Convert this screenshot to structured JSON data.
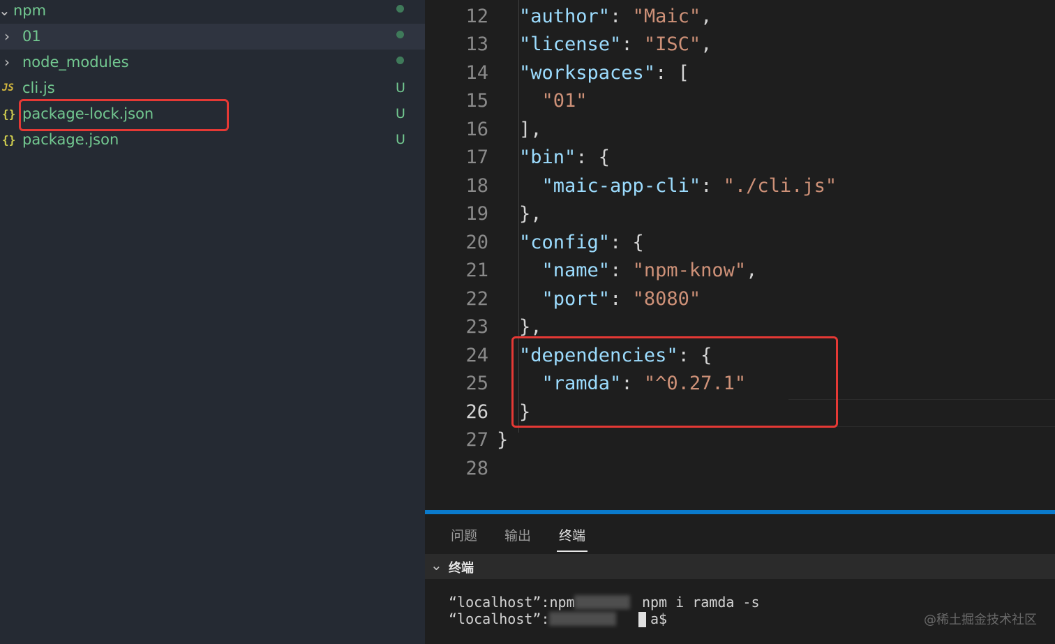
{
  "explorer": {
    "root_label": "npm",
    "items": [
      {
        "label": "01",
        "status": "dot"
      },
      {
        "label": "node_modules",
        "status": "dot"
      },
      {
        "label": "cli.js",
        "icon": "JS",
        "status": "U"
      },
      {
        "label": "package-lock.json",
        "icon": "{}",
        "status": "U"
      },
      {
        "label": "package.json",
        "icon": "{}",
        "status": "U"
      }
    ]
  },
  "editor": {
    "line_numbers": [
      "12",
      "13",
      "14",
      "15",
      "16",
      "17",
      "18",
      "19",
      "20",
      "21",
      "22",
      "23",
      "24",
      "25",
      "26",
      "27",
      "28"
    ],
    "active_line": "26"
  },
  "panel": {
    "tabs": [
      "问题",
      "输出",
      "终端"
    ],
    "active_tab": "终端",
    "terminal_title": "终端",
    "terminal_lines": [
      "“localhost”:npm        npm i ramda -s",
      "“localhost”:            a$ "
    ]
  },
  "watermark": "@稀土掘金技术社区",
  "colors": {
    "accent": "#0a7acc",
    "highlight_box": "#e53935",
    "untracked": "#73c991"
  }
}
